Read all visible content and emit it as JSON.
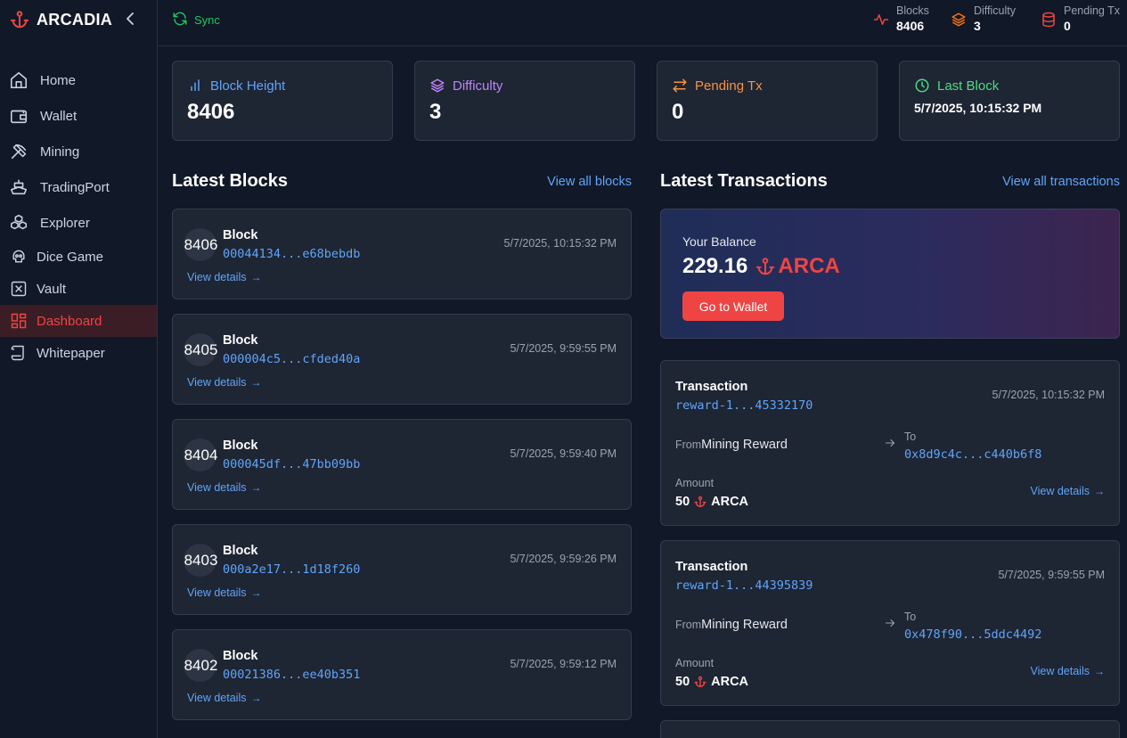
{
  "brand": {
    "name": "ARCADIA"
  },
  "sidebar": {
    "items": [
      {
        "label": "Home",
        "icon": "home-icon"
      },
      {
        "label": "Wallet",
        "icon": "wallet-icon"
      },
      {
        "label": "Mining",
        "icon": "pickaxe-icon"
      },
      {
        "label": "TradingPort",
        "icon": "ship-icon"
      },
      {
        "label": "Explorer",
        "icon": "boxes-icon"
      },
      {
        "label": "Dice Game",
        "icon": "skull-icon"
      },
      {
        "label": "Vault",
        "icon": "vault-icon"
      },
      {
        "label": "Dashboard",
        "icon": "dashboard-icon",
        "active": true
      },
      {
        "label": "Whitepaper",
        "icon": "scroll-icon"
      }
    ]
  },
  "topbar": {
    "sync_label": "Sync",
    "stats": [
      {
        "label": "Blocks",
        "value": "8406",
        "icon": "activity-icon",
        "color": "#ef4444"
      },
      {
        "label": "Difficulty",
        "value": "3",
        "icon": "layers-icon",
        "color": "#f97316"
      },
      {
        "label": "Pending Tx",
        "value": "0",
        "icon": "database-icon",
        "color": "#ef4444"
      }
    ]
  },
  "stat_cards": [
    {
      "label": "Block Height",
      "value": "8406",
      "color": "#60a5fa",
      "icon": "bar-chart-icon"
    },
    {
      "label": "Difficulty",
      "value": "3",
      "color": "#c084fc",
      "icon": "layers-icon"
    },
    {
      "label": "Pending Tx",
      "value": "0",
      "color": "#fb923c",
      "icon": "transfer-icon"
    },
    {
      "label": "Last Block",
      "value": "5/7/2025, 10:15:32 PM",
      "color": "#4ade80",
      "icon": "clock-icon"
    }
  ],
  "blocks_section": {
    "title": "Latest Blocks",
    "link": "View all blocks"
  },
  "tx_section": {
    "title": "Latest Transactions",
    "link": "View all transactions"
  },
  "blocks": [
    {
      "number": "8406",
      "title": "Block",
      "hash": "00044134...e68bebdb",
      "time": "5/7/2025, 10:15:32 PM",
      "details": "View details"
    },
    {
      "number": "8405",
      "title": "Block",
      "hash": "000004c5...cfded40a",
      "time": "5/7/2025, 9:59:55 PM",
      "details": "View details"
    },
    {
      "number": "8404",
      "title": "Block",
      "hash": "000045df...47bb09bb",
      "time": "5/7/2025, 9:59:40 PM",
      "details": "View details"
    },
    {
      "number": "8403",
      "title": "Block",
      "hash": "000a2e17...1d18f260",
      "time": "5/7/2025, 9:59:26 PM",
      "details": "View details"
    },
    {
      "number": "8402",
      "title": "Block",
      "hash": "00021386...ee40b351",
      "time": "5/7/2025, 9:59:12 PM",
      "details": "View details"
    }
  ],
  "balance": {
    "label": "Your Balance",
    "amount": "229.16",
    "currency": "ARCA",
    "button": "Go to Wallet"
  },
  "transactions": [
    {
      "title": "Transaction",
      "id": "reward-1...45332170",
      "time": "5/7/2025, 10:15:32 PM",
      "from_label": "From",
      "from": "Mining Reward",
      "to_label": "To",
      "to": "0x8d9c4c...c440b6f8",
      "amount_label": "Amount",
      "amount": "50",
      "currency": "ARCA",
      "details": "View details"
    },
    {
      "title": "Transaction",
      "id": "reward-1...44395839",
      "time": "5/7/2025, 9:59:55 PM",
      "from_label": "From",
      "from": "Mining Reward",
      "to_label": "To",
      "to": "0x478f90...5ddc4492",
      "amount_label": "Amount",
      "amount": "50",
      "currency": "ARCA",
      "details": "View details"
    }
  ]
}
